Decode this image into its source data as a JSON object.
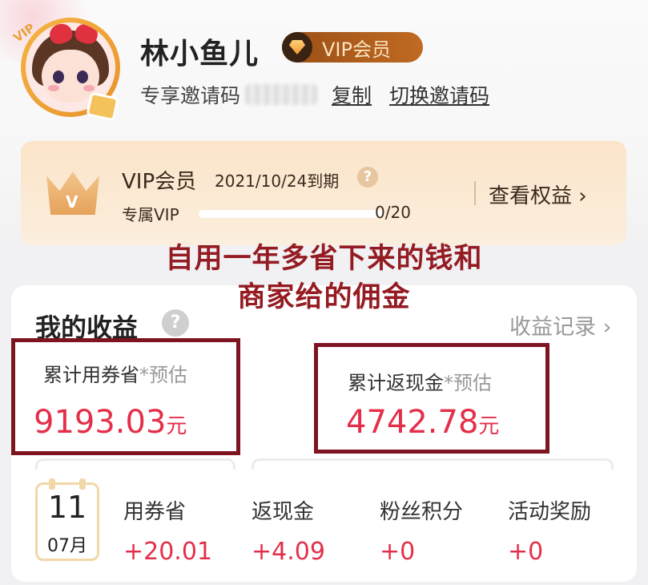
{
  "profile": {
    "name": "林小鱼儿",
    "vip_badge": "VIP会员",
    "invite_label": "专享邀请码",
    "copy_link": "复制",
    "switch_link": "切换邀请码",
    "avatar_badge": "VIP"
  },
  "vip_card": {
    "title": "VIP会员",
    "expire": "2021/10/24到期",
    "help": "?",
    "sub_label": "专属VIP",
    "progress_text": "0/20",
    "progress_fraction": 0,
    "benefits_link": "查看权益 ›",
    "crown_letter": "V"
  },
  "annotation": {
    "line1": "自用一年多省下来的钱和",
    "line2": "商家给的佣金"
  },
  "earnings": {
    "title": "我的收益",
    "help": "?",
    "record_link": "收益记录 ›",
    "coupon_saved": {
      "label": "累计用券省",
      "estimate": "*预估",
      "value": "9193.03",
      "unit": "元"
    },
    "cashback": {
      "label": "累计返现金",
      "estimate": "*预估",
      "value": "4742.78",
      "unit": "元"
    },
    "calendar": {
      "day": "11",
      "month": "07月"
    },
    "today": [
      {
        "label": "用券省",
        "value": "+20.01"
      },
      {
        "label": "返现金",
        "value": "+4.09"
      },
      {
        "label": "粉丝积分",
        "value": "+0"
      },
      {
        "label": "活动奖励",
        "value": "+0"
      }
    ]
  },
  "colors": {
    "accent_red": "#e42f4a",
    "annotation_red": "#951b22",
    "vip_brown": "#9a4f16"
  }
}
